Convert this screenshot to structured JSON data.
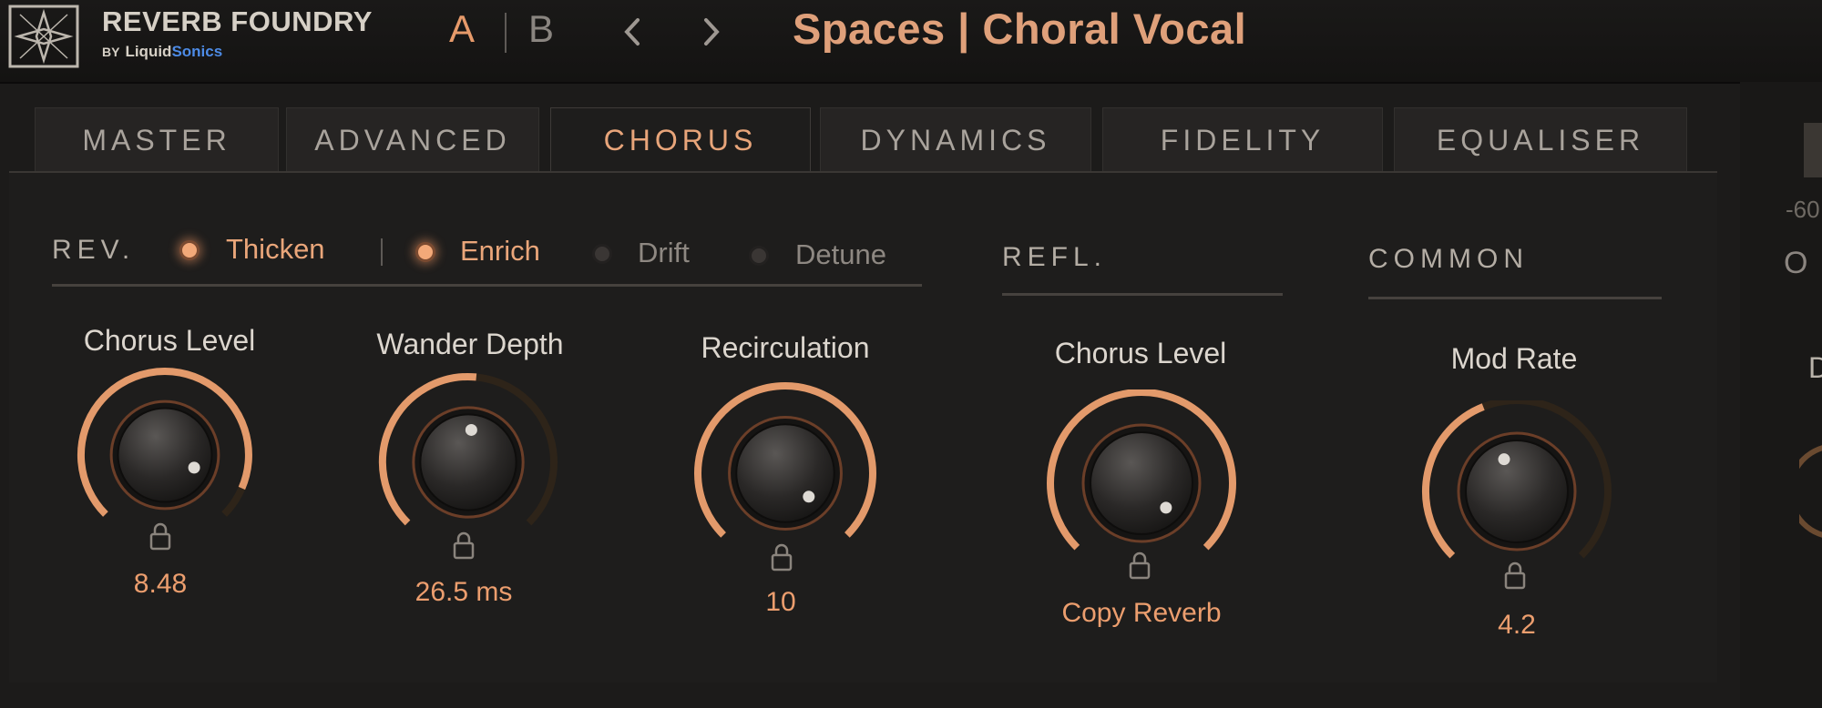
{
  "header": {
    "brand_name": "REVERB FOUNDRY",
    "brand_by": "BY",
    "brand_liquid": "Liquid",
    "brand_sonics": "Sonics",
    "ab_a": "A",
    "ab_b": "B",
    "preset_name": "Spaces | Choral Vocal"
  },
  "tabs": [
    {
      "label": "MASTER"
    },
    {
      "label": "ADVANCED"
    },
    {
      "label": "CHORUS"
    },
    {
      "label": "DYNAMICS"
    },
    {
      "label": "FIDELITY"
    },
    {
      "label": "EQUALISER"
    }
  ],
  "active_tab": "CHORUS",
  "sections": {
    "rev": {
      "label": "REV.",
      "options": [
        {
          "label": "Thicken",
          "on": true
        },
        {
          "label": "Enrich",
          "on": true
        },
        {
          "label": "Drift",
          "on": false
        },
        {
          "label": "Detune",
          "on": false
        }
      ]
    },
    "refl": {
      "label": "REFL."
    },
    "common": {
      "label": "COMMON"
    }
  },
  "knobs": [
    {
      "label": "Chorus Level",
      "value": "8.48",
      "fraction": 0.92
    },
    {
      "label": "Wander Depth",
      "value": "26.5 ms",
      "fraction": 0.52
    },
    {
      "label": "Recirculation",
      "value": "10",
      "fraction": 1.0
    },
    {
      "label": "Chorus Level",
      "value": "Copy Reverb",
      "fraction": 1.0
    },
    {
      "label": "Mod Rate",
      "value": "4.2",
      "fraction": 0.42
    }
  ],
  "right_strip": {
    "text1": "-60",
    "text2": "O",
    "text3": "D"
  },
  "colors": {
    "accent": "#e8a57a",
    "arc_active": "#e39a6b",
    "arc_track": "#2e2419",
    "brand_blue": "#4d8be6"
  }
}
